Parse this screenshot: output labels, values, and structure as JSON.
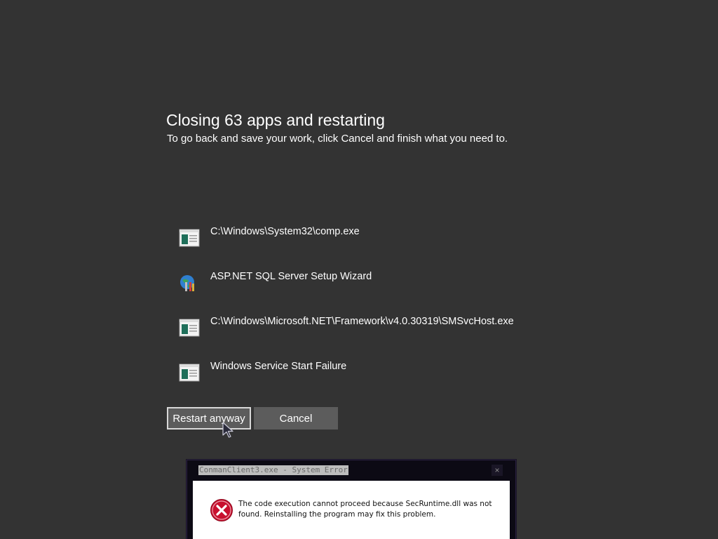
{
  "dialog": {
    "title": "Closing 63 apps and restarting",
    "subtitle": "To go back and save your work, click Cancel and finish what you need to."
  },
  "apps": [
    {
      "label": "C:\\Windows\\System32\\comp.exe",
      "icon": "app-window-icon"
    },
    {
      "label": "ASP.NET SQL Server Setup Wizard",
      "icon": "setup-wizard-icon"
    },
    {
      "label": "C:\\Windows\\Microsoft.NET\\Framework\\v4.0.30319\\SMSvcHost.exe",
      "icon": "app-window-icon"
    },
    {
      "label": "Windows Service Start Failure",
      "icon": "app-window-icon"
    }
  ],
  "buttons": {
    "restart": "Restart anyway",
    "cancel": "Cancel"
  },
  "error_dialog": {
    "title": "ConmanClient3.exe - System Error",
    "close": "×",
    "message": "The code execution cannot proceed because SecRuntime.dll was not found. Reinstalling the program may fix this problem.",
    "icon": "error-icon"
  },
  "colors": {
    "background": "#333333",
    "button": "#5c5c5c",
    "error_red": "#c8102e"
  }
}
